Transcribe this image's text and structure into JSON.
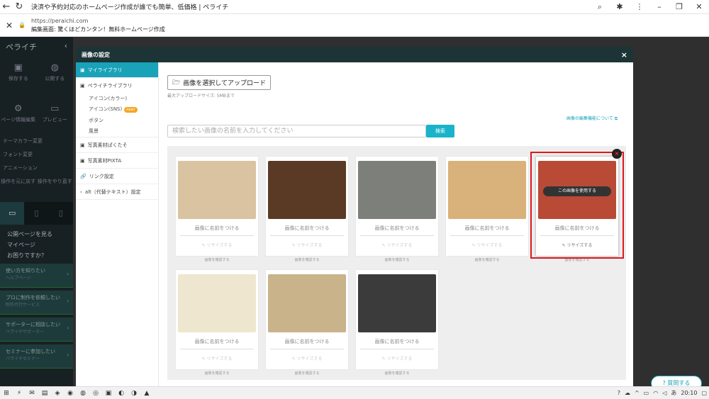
{
  "browser": {
    "tab_title": "決済や予約対応のホームページ作成が誰でも簡単、低価格 | ペライチ",
    "url": "https://peraichi.com",
    "page_title": "編集画面: 驚くほどカンタン！無料ホームページ作成"
  },
  "leftnav": {
    "logo": "ペライチ",
    "save": "保存する",
    "publish": "公開する",
    "page_info": "ページ情報編集",
    "preview": "プレビュー",
    "menu": [
      "テーマカラー変更",
      "フォント変更",
      "アニメーション"
    ],
    "history": [
      "操作を元に戻す",
      "操作をやり直す"
    ],
    "links": [
      "公開ページを見る",
      "マイページ",
      "お困りですか？"
    ],
    "ctas": [
      {
        "title": "使い方を知りたい",
        "sub": "ヘルプページ"
      },
      {
        "title": "プロに制作を依頼したい",
        "sub": "制作代行サービス"
      },
      {
        "title": "サポーターに相談したい",
        "sub": "ペライチサポーター"
      },
      {
        "title": "セミナーに参加したい",
        "sub": "ペライチセミナー"
      }
    ]
  },
  "modal": {
    "title": "画像の設定",
    "close": "×",
    "sidebar": {
      "items": [
        {
          "label": "マイライブラリ",
          "active": true
        },
        {
          "label": "ペライチライブラリ",
          "active": false
        }
      ],
      "subitems": [
        "アイコン(カラー)",
        "アイコン(SNS)",
        "ボタン",
        "風景"
      ],
      "new_badge": "new!",
      "more": [
        "写真素材ぱくたそ",
        "写真素材PIXTA",
        "リンク設定",
        "alt（代替テキスト）設定"
      ]
    },
    "upload_label": "画像を選択してアップロード",
    "upload_note": "最大アップロードサイズ: 5MBまで",
    "edit_link": "画像の編集機能について",
    "search_placeholder": "検索したい画像の名前を入力してください",
    "search_button": "検索",
    "use_image": "この画像を使用する",
    "cards": [
      {
        "name": "画像に名前をつける",
        "resize": "リサイズする",
        "check": "画像を確認する",
        "color": "#d9c3a0"
      },
      {
        "name": "画像に名前をつける",
        "resize": "リサイズする",
        "check": "画像を確認する",
        "color": "#5a3a24"
      },
      {
        "name": "画像に名前をつける",
        "resize": "リサイズする",
        "check": "画像を確認する",
        "color": "#7d7f7a"
      },
      {
        "name": "画像に名前をつける",
        "resize": "リサイズする",
        "check": "画像を確認する",
        "color": "#d8b27a"
      },
      {
        "name": "画像に名前をつける",
        "resize": "リサイズする",
        "check": "画像を確認する",
        "color": "#b94a36"
      },
      {
        "name": "画像に名前をつける",
        "resize": "リサイズする",
        "check": "画像を確認する",
        "color": "#efe6cf"
      },
      {
        "name": "画像に名前をつける",
        "resize": "リサイズする",
        "check": "画像を確認する",
        "color": "#c9b38a"
      },
      {
        "name": "画像に名前をつける",
        "resize": "リサイズする",
        "check": "画像を確認する",
        "color": "#3b3b3b"
      }
    ]
  },
  "help_button": "質問する",
  "taskbar": {
    "ime": "あ",
    "time": "20:10"
  },
  "colors": {
    "accent": "#19a2b8",
    "highlight": "#e0161e"
  }
}
